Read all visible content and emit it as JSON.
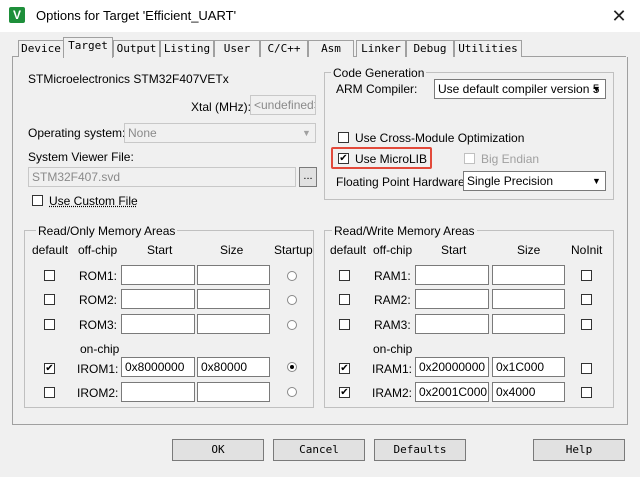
{
  "window": {
    "title": "Options for Target 'Efficient_UART'",
    "icon": "V",
    "close": "✕"
  },
  "tabs": [
    {
      "label": "Device"
    },
    {
      "label": "Target"
    },
    {
      "label": "Output"
    },
    {
      "label": "Listing"
    },
    {
      "label": "User"
    },
    {
      "label": "C/C++"
    },
    {
      "label": "Asm"
    },
    {
      "label": "Linker"
    },
    {
      "label": "Debug"
    },
    {
      "label": "Utilities"
    }
  ],
  "active_tab": "Target",
  "device": {
    "name": "STMicroelectronics STM32F407VETx"
  },
  "xtal": {
    "label": "Xtal (MHz):",
    "value": "<undefined>"
  },
  "os": {
    "label": "Operating system:",
    "value": "None"
  },
  "svd": {
    "label": "System Viewer File:",
    "value": "STM32F407.svd",
    "browse": "..."
  },
  "custom_file": {
    "label": "Use Custom File",
    "checked": false
  },
  "codegen": {
    "title": "Code Generation",
    "compiler_label": "ARM Compiler:",
    "compiler_value": "Use default compiler version 5",
    "cross_module": {
      "label": "Use Cross-Module Optimization",
      "checked": false
    },
    "microlib": {
      "label": "Use MicroLIB",
      "checked": true,
      "mark": "✔"
    },
    "big_endian": {
      "label": "Big Endian",
      "checked": false
    },
    "fp_label": "Floating Point Hardware:",
    "fp_value": "Single Precision"
  },
  "ro": {
    "title": "Read/Only Memory Areas",
    "headers": {
      "default": "default",
      "offchip": "off-chip",
      "start": "Start",
      "size": "Size",
      "startup": "Startup"
    },
    "onchip_label": "on-chip",
    "rows": [
      {
        "name": "ROM1:",
        "start": "",
        "size": "",
        "default": false,
        "selected": false
      },
      {
        "name": "ROM2:",
        "start": "",
        "size": "",
        "default": false,
        "selected": false
      },
      {
        "name": "ROM3:",
        "start": "",
        "size": "",
        "default": false,
        "selected": false
      },
      {
        "name": "IROM1:",
        "start": "0x8000000",
        "size": "0x80000",
        "default": true,
        "selected": true
      },
      {
        "name": "IROM2:",
        "start": "",
        "size": "",
        "default": false,
        "selected": false
      }
    ]
  },
  "rw": {
    "title": "Read/Write Memory Areas",
    "headers": {
      "default": "default",
      "offchip": "off-chip",
      "start": "Start",
      "size": "Size",
      "noinit": "NoInit"
    },
    "onchip_label": "on-chip",
    "rows": [
      {
        "name": "RAM1:",
        "start": "",
        "size": "",
        "default": false
      },
      {
        "name": "RAM2:",
        "start": "",
        "size": "",
        "default": false
      },
      {
        "name": "RAM3:",
        "start": "",
        "size": "",
        "default": false
      },
      {
        "name": "IRAM1:",
        "start": "0x20000000",
        "size": "0x1C000",
        "default": true
      },
      {
        "name": "IRAM2:",
        "start": "0x2001C000",
        "size": "0x4000",
        "default": true
      }
    ]
  },
  "buttons": {
    "ok": "OK",
    "cancel": "Cancel",
    "defaults": "Defaults",
    "help": "Help"
  },
  "colors": {
    "highlight": "#e24a3b",
    "icon": "#1e8f3a"
  }
}
